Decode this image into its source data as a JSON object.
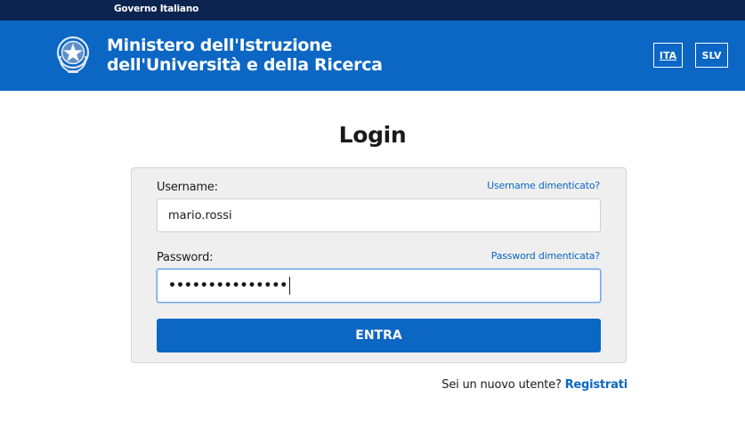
{
  "gov_bar": {
    "label": "Governo Italiano"
  },
  "header": {
    "ministry_line1": "Ministero dell'Istruzione",
    "ministry_line2": "dell'Università e della Ricerca",
    "emblem_icon": "italian-republic-emblem-icon",
    "languages": [
      {
        "label": "ITA",
        "selected": true
      },
      {
        "label": "SLV",
        "selected": false
      }
    ]
  },
  "page": {
    "title": "Login"
  },
  "form": {
    "username_label": "Username:",
    "username_forgot": "Username dimenticato?",
    "username_value": "mario.rossi",
    "password_label": "Password:",
    "password_forgot": "Password dimenticata?",
    "password_masked": "•••••••••••••••",
    "submit_label": "ENTRA"
  },
  "register": {
    "prompt": "Sei un nuovo utente?",
    "link": "Registrati"
  },
  "colors": {
    "gov_bar": "#0c2450",
    "header": "#0b66c4",
    "accent": "#0b66c4",
    "panel_bg": "#efefef"
  }
}
